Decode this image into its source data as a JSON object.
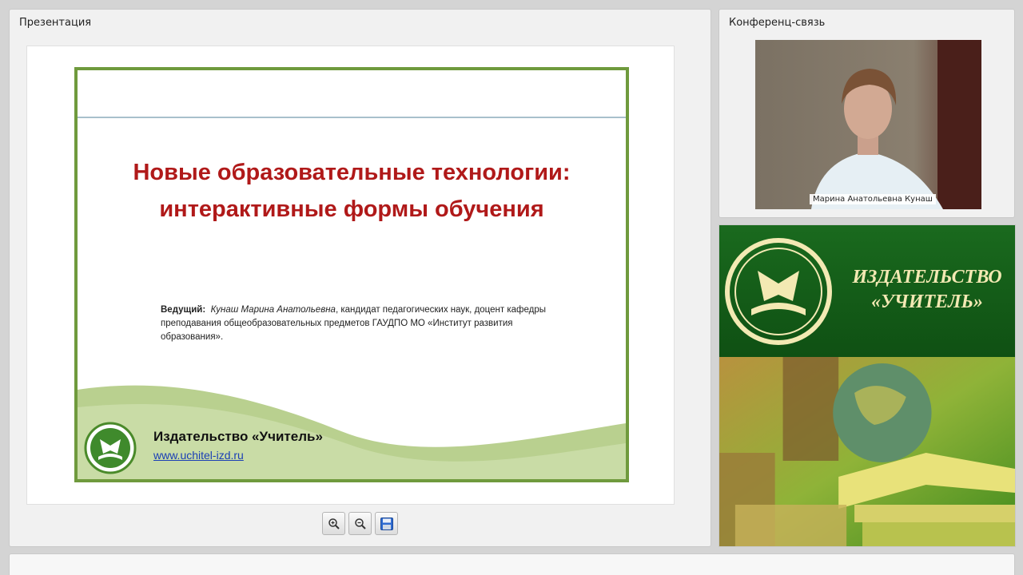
{
  "presentation_panel": {
    "title": "Презентация",
    "slide": {
      "title_line1": "Новые образовательные технологии:",
      "title_line2": "интерактивные формы обучения",
      "presenter_label": "Ведущий:",
      "presenter_name": "Кунаш Марина Анатольевна",
      "presenter_desc": ", кандидат педагогических наук, доцент кафедры преподавания общеобразовательных предметов ГАУДПО МО «Институт развития образования».",
      "publisher": "Издательство «Учитель»",
      "url": "www.uchitel-izd.ru"
    },
    "toolbar": {
      "zoom_in_icon": "zoom-in-icon",
      "zoom_out_icon": "zoom-out-icon",
      "save_icon": "save-icon"
    }
  },
  "conference_panel": {
    "title": "Конференц-связь",
    "participant_name": "Марина Анатольевна Кунаш"
  },
  "banner": {
    "name_line1": "ИЗДАТЕЛЬСТВО",
    "name_line2": "«УЧИТЕЛЬ»"
  },
  "colors": {
    "slide_border": "#6f9a3d",
    "slide_title": "#b01919",
    "banner_green": "#1a6a1e",
    "banner_text": "#f3e9b3"
  }
}
